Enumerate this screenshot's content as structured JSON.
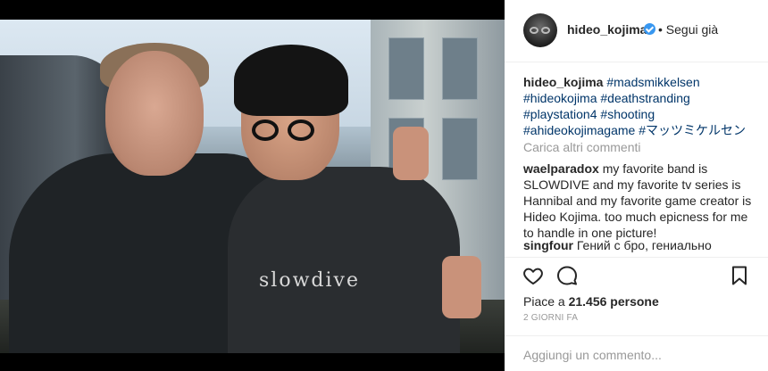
{
  "post": {
    "username": "hideo_kojima",
    "follow_separator": "•",
    "follow_label": "Segui già",
    "image_shirt_text": "slowdive"
  },
  "caption": {
    "username": "hideo_kojima",
    "tags": [
      "#madsmikkelsen",
      "#hideokojima",
      "#deathstranding",
      "#playstation4",
      "#shooting",
      "#ahideokojimagame",
      "#マッツミケルセン"
    ]
  },
  "load_more_comments": "Carica altri commenti",
  "comments": [
    {
      "username": "waelparadox",
      "text": "my favorite band is SLOWDIVE and my favorite tv series is Hannibal and my favorite game creator is Hideo Kojima. too much epicness for me to handle in one picture!"
    },
    {
      "username": "singfour",
      "text": "Гений с бро, гениально"
    }
  ],
  "actions": {
    "like_icon": "heart-icon",
    "comment_icon": "comment-bubble-icon",
    "save_icon": "bookmark-icon"
  },
  "likes": {
    "prefix": "Piace a ",
    "count": "21.456",
    "suffix": " persone"
  },
  "timestamp": "2 GIORNI FA",
  "add_comment_placeholder": "Aggiungi un commento...",
  "colors": {
    "verified_blue": "#3897f0",
    "hashtag_blue": "#003569",
    "muted_gray": "#999999",
    "text_dark": "#262626"
  }
}
